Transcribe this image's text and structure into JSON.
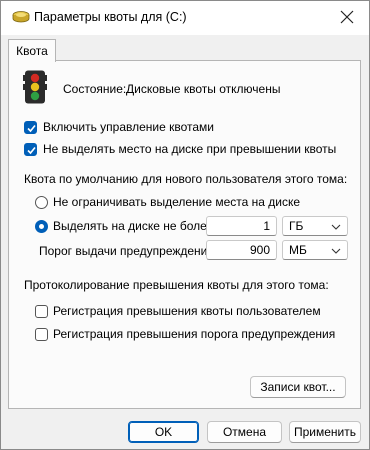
{
  "window": {
    "title": "Параметры квоты для  (C:)",
    "title_icon": "drive-icon",
    "close_icon": "close-icon"
  },
  "tabs": [
    {
      "label": "Квота",
      "active": true
    }
  ],
  "status": {
    "icon": "traffic-light-icon",
    "label": "Состояние:",
    "value": "Дисковые квоты отключены"
  },
  "checkboxes": {
    "enable_quota": {
      "label": "Включить управление квотами",
      "checked": true
    },
    "deny_space": {
      "label": "Не выделять место на диске при превышении квоты",
      "checked": true
    }
  },
  "default_quota": {
    "heading": "Квота по умолчанию для нового пользователя этого тома:",
    "no_limit_label": "Не ограничивать выделение места на диске",
    "limit_label": "Выделять на диске не более",
    "limit_value": "1",
    "limit_unit": "ГБ",
    "warning_label": "Порог выдачи предупреждений",
    "warning_value": "900",
    "warning_unit": "МБ"
  },
  "logging": {
    "heading": "Протоколирование превышения квоты для этого тома:",
    "log_quota_label": "Регистрация превышения квоты пользователем",
    "log_warning_label": "Регистрация превышения порога предупреждения"
  },
  "buttons": {
    "quota_entries": "Записи квот...",
    "ok": "OK",
    "cancel": "Отмена",
    "apply": "Применить"
  },
  "colors": {
    "accent": "#005fb8",
    "light_red": "#d32a22",
    "light_yellow": "#e8c21e",
    "light_green": "#2ea043"
  }
}
